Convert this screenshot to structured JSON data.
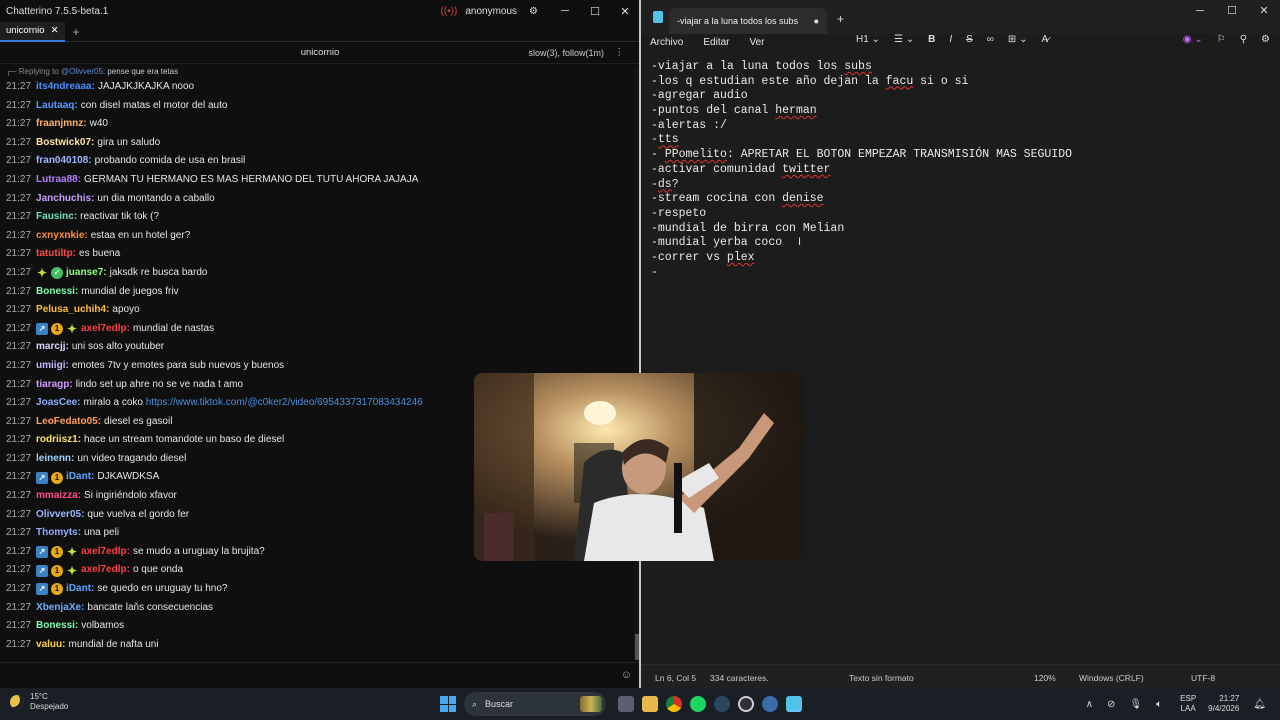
{
  "chatterino": {
    "title": "Chatterino 7.5.5-beta.1",
    "user": "anonymous",
    "tab": "unicornio",
    "channel": "unicornio",
    "modes": "slow(3), follow(1m)",
    "reply_prefix": "Replying to",
    "reply_user": "@Olivver05:",
    "reply_text": "pense que era tetas",
    "messages": [
      {
        "ts": "21:27",
        "user": "its4ndreaaa:",
        "text": "JAJAJKJKAJKA nooo",
        "color": "#4a90ff",
        "badges": []
      },
      {
        "ts": "21:27",
        "user": "Lautaaq:",
        "text": "con disel matas el motor del auto",
        "color": "#5b9bff",
        "badges": []
      },
      {
        "ts": "21:27",
        "user": "fraanjmnz:",
        "text": "w40",
        "color": "#ffb36b",
        "badges": []
      },
      {
        "ts": "21:27",
        "user": "Bostwick07:",
        "text": "gira un saludo",
        "color": "#ffe3a3",
        "badges": []
      },
      {
        "ts": "21:27",
        "user": "fran040108:",
        "text": "probando comida de usa en brasil",
        "color": "#9fb8ff",
        "badges": []
      },
      {
        "ts": "21:27",
        "user": "Lutraa88:",
        "text": "GERMAN TU HERMANO ES MAS HERMANO DEL TUTU AHORA JAJAJA",
        "color": "#b57dff",
        "badges": []
      },
      {
        "ts": "21:27",
        "user": "Janchuchis:",
        "text": "un dia montando a caballo",
        "color": "#c79fff",
        "badges": []
      },
      {
        "ts": "21:27",
        "user": "Fausinc:",
        "text": "reactivar tik tok (?",
        "color": "#6ee0b0",
        "badges": []
      },
      {
        "ts": "21:27",
        "user": "cxnyxnkie:",
        "text": "estaa en un hotel ger?",
        "color": "#ff8c3a",
        "badges": []
      },
      {
        "ts": "21:27",
        "user": "tatutiltp:",
        "text": "es buena",
        "color": "#ff4b4b",
        "badges": []
      },
      {
        "ts": "21:27",
        "user": "juanse7:",
        "text": "jaksdk re busca bardo",
        "color": "#8fff7a",
        "badges": [
          "star",
          "verif"
        ]
      },
      {
        "ts": "21:27",
        "user": "Bonessi:",
        "text": "mundial de juegos friv",
        "color": "#7dffb0",
        "badges": []
      },
      {
        "ts": "21:27",
        "user": "Pelusa_uchih4:",
        "text": "apoyo",
        "color": "#ffbe3d",
        "badges": []
      },
      {
        "ts": "21:27",
        "user": "axel7edlp:",
        "text": "mundial de nastas",
        "color": "#ff3f3f",
        "badges": [
          "arrow",
          "one",
          "star"
        ]
      },
      {
        "ts": "21:27",
        "user": "marcjj:",
        "text": "uni sos alto youtuber",
        "color": "#d8d8ff",
        "badges": []
      },
      {
        "ts": "21:27",
        "user": "umiigi:",
        "text": "emotes 7tv y emotes para sub nuevos y buenos",
        "color": "#c9b8ff",
        "badges": []
      },
      {
        "ts": "21:27",
        "user": "tiaragp:",
        "text": "lindo set up ahre no se ve nada t amo",
        "color": "#d69bff",
        "badges": []
      },
      {
        "ts": "21:27",
        "user": "JoasCee:",
        "text": "miralo a coko ",
        "link": "https://www.tiktok.com/@c0ker2/video/6954337317083434246",
        "color": "#8fb2ff",
        "badges": []
      },
      {
        "ts": "21:27",
        "user": "LeoFedato05:",
        "text": "diesel es gasoil",
        "color": "#ff9d5c",
        "badges": []
      },
      {
        "ts": "21:27",
        "user": "rodriisz1:",
        "text": "hace un stream tomandote un baso de diesel",
        "color": "#ffe46b",
        "badges": []
      },
      {
        "ts": "21:27",
        "user": "leinenn:",
        "text": "un video tragando diesel",
        "color": "#9fd3ff",
        "badges": []
      },
      {
        "ts": "21:27",
        "user": "iDant:",
        "text": "DJKAWDKSA",
        "color": "#5aa6ff",
        "badges": [
          "arrow",
          "one"
        ]
      },
      {
        "ts": "21:27",
        "user": "mmaizza:",
        "text": "Si ingiriéndolo xfavor",
        "color": "#ff4f8b",
        "badges": []
      },
      {
        "ts": "21:27",
        "user": "Olivver05:",
        "text": "que vuelva el gordo fer",
        "color": "#9bb7ff",
        "badges": []
      },
      {
        "ts": "21:27",
        "user": "Thomyts:",
        "text": "una peli",
        "color": "#8fa9ff",
        "badges": []
      },
      {
        "ts": "21:27",
        "user": "axel7edlp:",
        "text": "se mudo a uruguay la brujita?",
        "color": "#ff3f3f",
        "badges": [
          "arrow",
          "one",
          "star"
        ]
      },
      {
        "ts": "21:27",
        "user": "axel7edlp:",
        "text": "o que onda",
        "color": "#ff3f3f",
        "badges": [
          "arrow",
          "one",
          "star"
        ]
      },
      {
        "ts": "21:27",
        "user": "iDant:",
        "text": "se quedo en uruguay tu hno?",
        "color": "#5aa6ff",
        "badges": [
          "arrow",
          "one"
        ]
      },
      {
        "ts": "21:27",
        "user": "XbenjaXe:",
        "text": "bancate laňs consecuencias",
        "color": "#6ab0ff",
        "badges": []
      },
      {
        "ts": "21:27",
        "user": "Bonessi:",
        "text": "volbamos",
        "color": "#7dffb0",
        "badges": []
      },
      {
        "ts": "21:27",
        "user": "valuu:",
        "text": "mundial de nafta uni",
        "color": "#ffd24d",
        "badges": []
      }
    ]
  },
  "notepad": {
    "tab_title": "-viajar a la luna todos los subs",
    "menu": [
      "Archivo",
      "Editar",
      "Ver"
    ],
    "heading_btn": "H1",
    "lines": [
      [
        {
          "t": "-viajar a la luna todos los "
        },
        {
          "t": "subs",
          "sq": true
        }
      ],
      [
        {
          "t": "-los q estudian este año dejan la "
        },
        {
          "t": "facu",
          "sq": true
        },
        {
          "t": " si o si"
        }
      ],
      [
        {
          "t": "-agregar audio"
        }
      ],
      [
        {
          "t": "-puntos del canal "
        },
        {
          "t": "herman",
          "sq": true
        }
      ],
      [
        {
          "t": "-alertas :/"
        }
      ],
      [
        {
          "t": "-"
        },
        {
          "t": "tts",
          "sq": true
        }
      ],
      [
        {
          "t": "- "
        },
        {
          "t": "PPomelito",
          "sq": true
        },
        {
          "t": ": APRETAR EL BOTON EMPEZAR TRANSMISIÓN MAS SEGUIDO"
        }
      ],
      [
        {
          "t": "-activar comunidad "
        },
        {
          "t": "twitter",
          "sq": true
        }
      ],
      [
        {
          "t": "-"
        },
        {
          "t": "ds",
          "sq": true
        },
        {
          "t": "?"
        }
      ],
      [
        {
          "t": "-stream cocina con "
        },
        {
          "t": "denise",
          "sq": true
        }
      ],
      [
        {
          "t": "-respeto"
        }
      ],
      [
        {
          "t": "-mundial de birra con Melian"
        }
      ],
      [
        {
          "t": "-mundial yerba coco"
        }
      ],
      [
        {
          "t": "-correr vs "
        },
        {
          "t": "plex",
          "sq": true
        }
      ],
      [
        {
          "t": "-"
        }
      ]
    ],
    "status": {
      "pos": "Ln 6, Col 5",
      "chars": "334 caracteres.",
      "format": "Texto sin formato",
      "zoom": "120%",
      "eol": "Windows (CRLF)",
      "enc": "UTF-8"
    }
  },
  "taskbar": {
    "temp": "15°C",
    "weather": "Despejado",
    "search": "Buscar",
    "lang1": "ESP",
    "lang2": "LAA",
    "time": "21:27",
    "date": "9/4/2026"
  }
}
